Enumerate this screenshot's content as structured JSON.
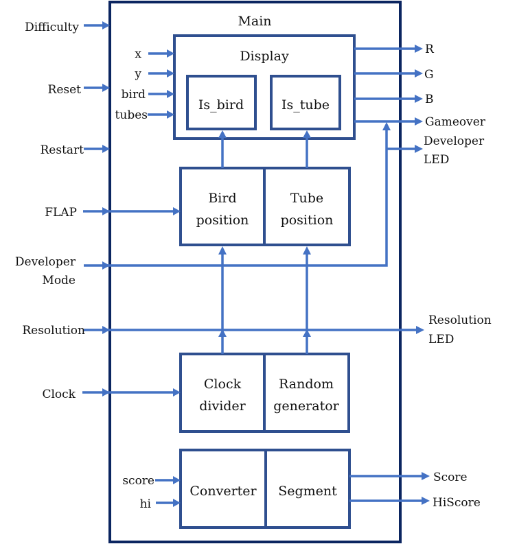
{
  "diagram": {
    "title": "Main",
    "colors": {
      "main_border": "#0b2560",
      "block_border": "#2f4f8f",
      "wire": "#4472c4",
      "text": "#111111"
    },
    "inputs": {
      "difficulty": "Difficulty",
      "reset": "Reset",
      "restart": "Restart",
      "flap": "FLAP",
      "developer_mode_line1": "Developer",
      "developer_mode_line2": "Mode",
      "resolution": "Resolution",
      "clock": "Clock"
    },
    "display_inputs": {
      "x": "x",
      "y": "y",
      "bird": "bird",
      "tubes": "tubes"
    },
    "segment_inputs": {
      "score": "score",
      "hi": "hi"
    },
    "outputs": {
      "r": "R",
      "g": "G",
      "b": "B",
      "gameover": "Gameover",
      "developer_led_line1": "Developer",
      "developer_led_line2": "LED",
      "resolution_led_line1": "Resolution",
      "resolution_led_line2": "LED",
      "score": "Score",
      "hiscore": "HiScore"
    },
    "blocks": {
      "display": "Display",
      "is_bird": "Is_bird",
      "is_tube": "Is_tube",
      "bird_position_line1": "Bird",
      "bird_position_line2": "position",
      "tube_position_line1": "Tube",
      "tube_position_line2": "position",
      "clock_divider_line1": "Clock",
      "clock_divider_line2": "divider",
      "random_generator_line1": "Random",
      "random_generator_line2": "generator",
      "converter": "Converter",
      "segment": "Segment"
    }
  }
}
